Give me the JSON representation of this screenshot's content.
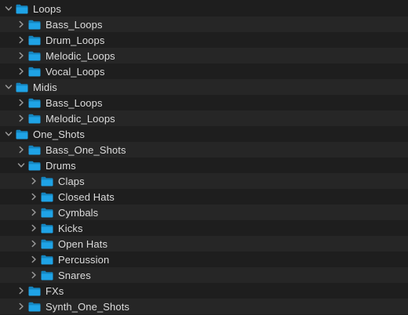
{
  "tree": {
    "rows": [
      {
        "label": "Loops",
        "depth": 0,
        "expanded": true,
        "icon": "folder-icon",
        "chevron": "chevron-down-icon"
      },
      {
        "label": "Bass_Loops",
        "depth": 1,
        "expanded": false,
        "icon": "folder-icon",
        "chevron": "chevron-right-icon"
      },
      {
        "label": "Drum_Loops",
        "depth": 1,
        "expanded": false,
        "icon": "folder-icon",
        "chevron": "chevron-right-icon"
      },
      {
        "label": "Melodic_Loops",
        "depth": 1,
        "expanded": false,
        "icon": "folder-icon",
        "chevron": "chevron-right-icon"
      },
      {
        "label": "Vocal_Loops",
        "depth": 1,
        "expanded": false,
        "icon": "folder-icon",
        "chevron": "chevron-right-icon"
      },
      {
        "label": "Midis",
        "depth": 0,
        "expanded": true,
        "icon": "folder-icon",
        "chevron": "chevron-down-icon"
      },
      {
        "label": "Bass_Loops",
        "depth": 1,
        "expanded": false,
        "icon": "folder-icon",
        "chevron": "chevron-right-icon"
      },
      {
        "label": "Melodic_Loops",
        "depth": 1,
        "expanded": false,
        "icon": "folder-icon",
        "chevron": "chevron-right-icon"
      },
      {
        "label": "One_Shots",
        "depth": 0,
        "expanded": true,
        "icon": "folder-icon",
        "chevron": "chevron-down-icon"
      },
      {
        "label": "Bass_One_Shots",
        "depth": 1,
        "expanded": false,
        "icon": "folder-icon",
        "chevron": "chevron-right-icon"
      },
      {
        "label": "Drums",
        "depth": 1,
        "expanded": true,
        "icon": "folder-icon",
        "chevron": "chevron-down-icon"
      },
      {
        "label": "Claps",
        "depth": 2,
        "expanded": false,
        "icon": "folder-icon",
        "chevron": "chevron-right-icon"
      },
      {
        "label": "Closed Hats",
        "depth": 2,
        "expanded": false,
        "icon": "folder-icon",
        "chevron": "chevron-right-icon"
      },
      {
        "label": "Cymbals",
        "depth": 2,
        "expanded": false,
        "icon": "folder-icon",
        "chevron": "chevron-right-icon"
      },
      {
        "label": "Kicks",
        "depth": 2,
        "expanded": false,
        "icon": "folder-icon",
        "chevron": "chevron-right-icon"
      },
      {
        "label": "Open Hats",
        "depth": 2,
        "expanded": false,
        "icon": "folder-icon",
        "chevron": "chevron-right-icon"
      },
      {
        "label": "Percussion",
        "depth": 2,
        "expanded": false,
        "icon": "folder-icon",
        "chevron": "chevron-right-icon"
      },
      {
        "label": "Snares",
        "depth": 2,
        "expanded": false,
        "icon": "folder-icon",
        "chevron": "chevron-right-icon"
      },
      {
        "label": "FXs",
        "depth": 1,
        "expanded": false,
        "icon": "folder-icon",
        "chevron": "chevron-right-icon"
      },
      {
        "label": "Synth_One_Shots",
        "depth": 1,
        "expanded": false,
        "icon": "folder-icon",
        "chevron": "chevron-right-icon"
      }
    ]
  },
  "colors": {
    "background": "#1e1e1e",
    "alt_row": "#262626",
    "text": "#dcdcdc",
    "chevron": "#9a9a9a",
    "folder_front": "#1fa3e6",
    "folder_back": "#1585c0"
  }
}
